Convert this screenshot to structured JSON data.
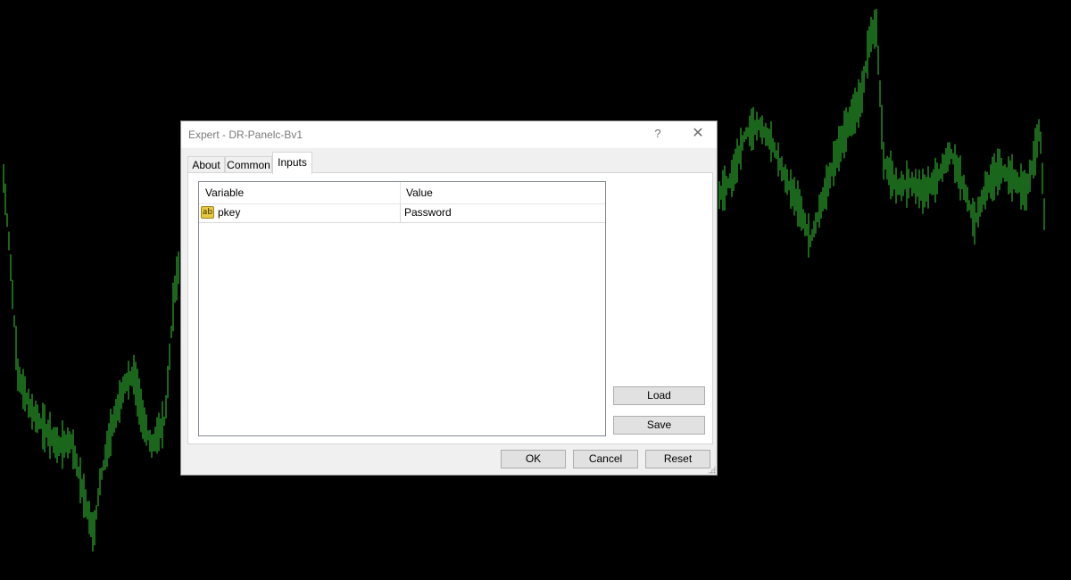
{
  "dialog": {
    "title": "Expert - DR-Panelc-Bv1",
    "help_symbol": "?",
    "close_symbol": "✕",
    "tabs": [
      {
        "label": "About",
        "active": false
      },
      {
        "label": "Common",
        "active": false
      },
      {
        "label": "Inputs",
        "active": true
      }
    ],
    "inputs_table": {
      "columns": [
        "Variable",
        "Value"
      ],
      "rows": [
        {
          "icon": "string-input-icon",
          "icon_text": "ab",
          "variable": "pkey",
          "value": "Password"
        }
      ]
    },
    "side_buttons": {
      "load": "Load",
      "save": "Save"
    },
    "footer_buttons": {
      "ok": "OK",
      "cancel": "Cancel",
      "reset": "Reset"
    }
  },
  "background": {
    "color": "#000000",
    "price_line_color": "#33cc33"
  }
}
